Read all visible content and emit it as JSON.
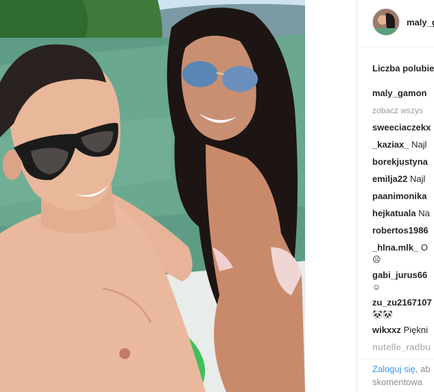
{
  "post": {
    "author": "maly_gamon",
    "likes_label": "Liczba polubie",
    "caption_author": "maly_gamon",
    "view_all_label": "zobacz wszys"
  },
  "comments": [
    {
      "user": "sweeciaczekx",
      "text": ""
    },
    {
      "user": "_kaziax_",
      "text": "Najl"
    },
    {
      "user": "borekjustyna",
      "text": ""
    },
    {
      "user": "emilja22",
      "text": "Najl"
    },
    {
      "user": "paanimonika",
      "text": ""
    },
    {
      "user": "hejkatuala",
      "text": "Na"
    },
    {
      "user": "robertos1986",
      "text": ""
    },
    {
      "user": "_hlna.mlk_",
      "text": "O",
      "emoji": "☹"
    },
    {
      "user": "gabi_jurus66",
      "text": "",
      "emoji": "☺"
    },
    {
      "user": "zu_zu2167107",
      "text": "",
      "emoji": "🐼🐼"
    },
    {
      "user": "wikxxz",
      "text": "Piękni"
    },
    {
      "user": "nutelle_radbu",
      "text": ""
    }
  ],
  "login": {
    "link_label": "Zaloguj się",
    "rest": ", ab",
    "line2": "skomentowa"
  },
  "colors": {
    "link": "#3897f0",
    "text": "#262626",
    "muted": "#999999"
  },
  "icons": {
    "watermark": "watermark-logo-icon"
  }
}
